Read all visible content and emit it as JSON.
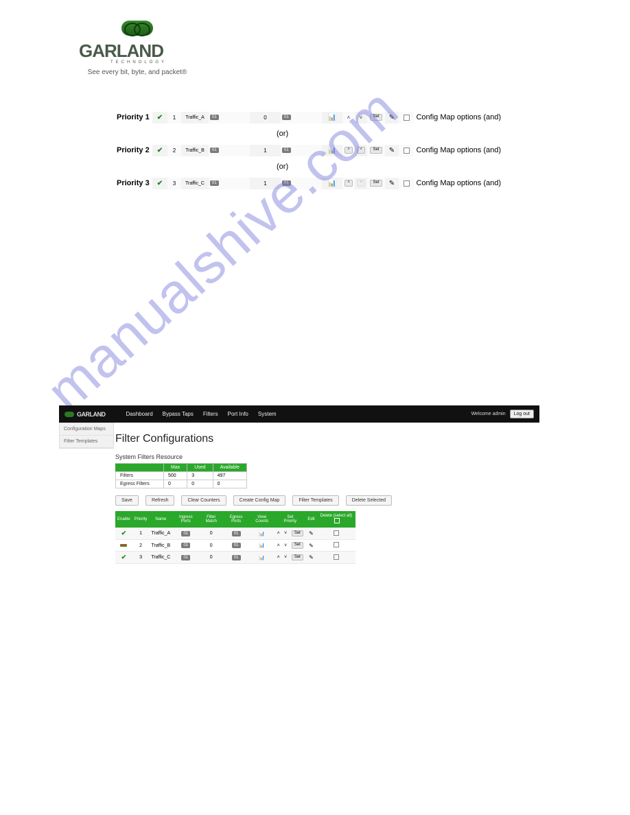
{
  "brand": {
    "name": "GARLAND",
    "tech": "TECHNOLOGY",
    "tagline": "See every bit, byte, and packet®"
  },
  "watermark": "manualshive.com",
  "priority_rows": [
    {
      "label": "Priority 1",
      "pri": "1",
      "name": "Traffic_A",
      "ing": "01",
      "fm": "0",
      "eg": "01",
      "set": "Set",
      "opts": "Config Map options (and)"
    },
    {
      "label": "Priority 2",
      "pri": "2",
      "name": "Traffic_B",
      "ing": "01",
      "fm": "1",
      "eg": "01",
      "set": "Set",
      "opts": "Config Map options (and)"
    },
    {
      "label": "Priority 3",
      "pri": "3",
      "name": "Traffic_C",
      "ing": "01",
      "fm": "1",
      "eg": "01",
      "set": "Set",
      "opts": "Config Map options (and)"
    }
  ],
  "or": "(or)",
  "nav": [
    "Dashboard",
    "Bypass Taps",
    "Filters",
    "Port Info",
    "System"
  ],
  "welcome": "Welcome admin",
  "logout": "Log out",
  "sidebar": [
    "Configuration Maps",
    "Filter Templates"
  ],
  "page_title": "Filter Configurations",
  "subtitle": "System Filters Resource",
  "resource": {
    "headers": [
      "",
      "Max",
      "Used",
      "Available"
    ],
    "rows": [
      {
        "lbl": "Filters",
        "max": "500",
        "used": "3",
        "avail": "497"
      },
      {
        "lbl": "Egress Filters",
        "max": "0",
        "used": "0",
        "avail": "0"
      }
    ]
  },
  "buttons": [
    "Save",
    "Refresh",
    "Clear Counters",
    "Create Config Map",
    "Filter Templates",
    "Delete Selected"
  ],
  "cfg_headers": {
    "enable": "Enable",
    "priority": "Priority",
    "name": "Name",
    "ingress": "Ingress Ports",
    "fm": "Filter Match",
    "egress": "Egress Ports",
    "view": "View Counts",
    "setpri": "Set Priority",
    "edit": "Edit",
    "del": "Delete (select all)"
  },
  "cfg_rows": [
    {
      "enable": "g",
      "pri": "1",
      "name": "Traffic_A",
      "ing": "01",
      "fm": "0",
      "eg": "01",
      "set": "Set"
    },
    {
      "enable": "r",
      "pri": "2",
      "name": "Traffic_B",
      "ing": "01",
      "fm": "0",
      "eg": "01",
      "set": "Set"
    },
    {
      "enable": "g",
      "pri": "3",
      "name": "Traffic_C",
      "ing": "01",
      "fm": "0",
      "eg": "01",
      "set": "Set"
    }
  ]
}
